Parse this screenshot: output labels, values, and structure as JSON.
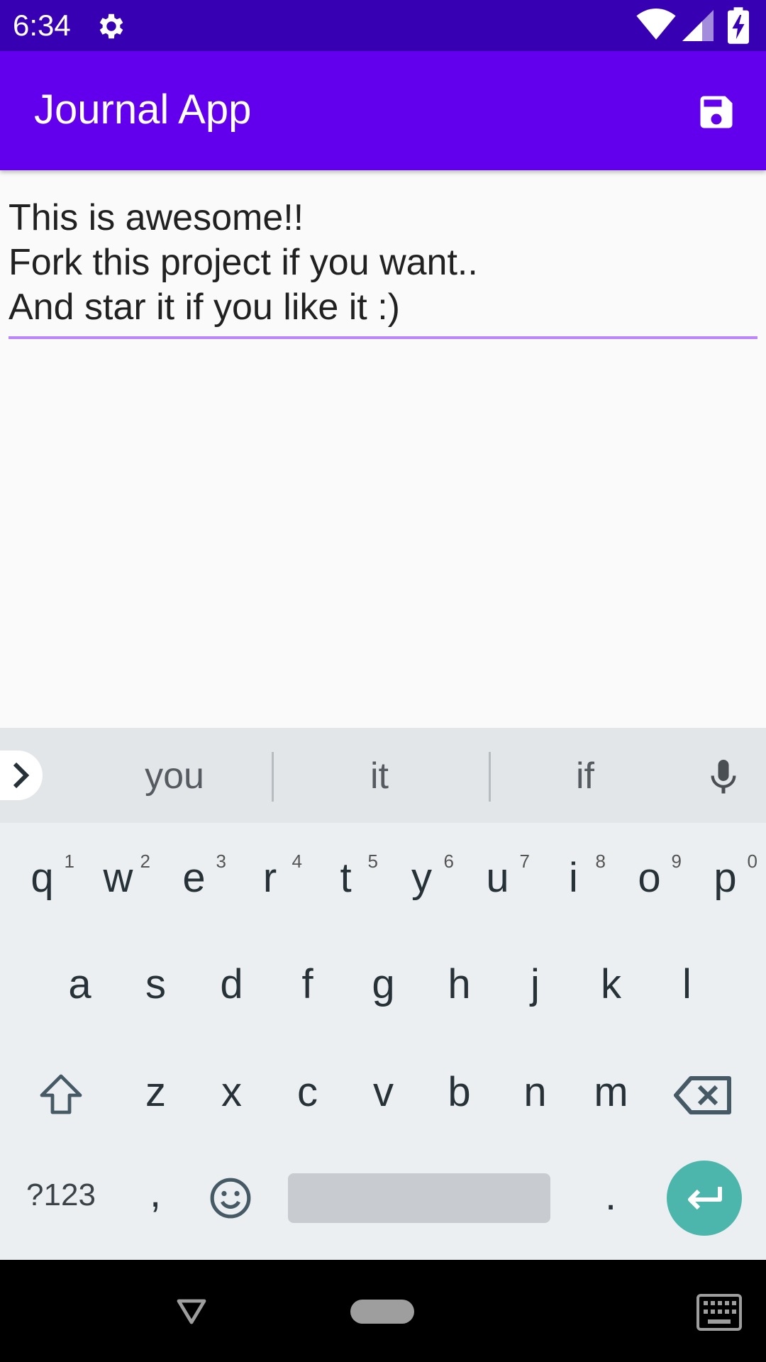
{
  "status_bar": {
    "time": "6:34",
    "icons": [
      "gear-icon",
      "wifi-icon",
      "signal-icon",
      "battery-charging-icon"
    ]
  },
  "app_bar": {
    "title": "Journal App",
    "action_icon": "save-icon"
  },
  "editor": {
    "text": "This is awesome!!\nFork this project if you want..\nAnd star it if you like it :)",
    "underline_color": "#bb86fc"
  },
  "keyboard": {
    "suggestions": [
      "you",
      "it",
      "if"
    ],
    "row1": [
      {
        "key": "q",
        "hint": "1"
      },
      {
        "key": "w",
        "hint": "2"
      },
      {
        "key": "e",
        "hint": "3"
      },
      {
        "key": "r",
        "hint": "4"
      },
      {
        "key": "t",
        "hint": "5"
      },
      {
        "key": "y",
        "hint": "6"
      },
      {
        "key": "u",
        "hint": "7"
      },
      {
        "key": "i",
        "hint": "8"
      },
      {
        "key": "o",
        "hint": "9"
      },
      {
        "key": "p",
        "hint": "0"
      }
    ],
    "row2": [
      "a",
      "s",
      "d",
      "f",
      "g",
      "h",
      "j",
      "k",
      "l"
    ],
    "row3": [
      "z",
      "x",
      "c",
      "v",
      "b",
      "n",
      "m"
    ],
    "symbols_label": "?123",
    "comma": ",",
    "period": ".",
    "enter_color": "#4db6ac"
  },
  "colors": {
    "status_bar": "#3700b3",
    "app_bar": "#6200ee",
    "background": "#fafafa",
    "keyboard": "#eceff1"
  }
}
